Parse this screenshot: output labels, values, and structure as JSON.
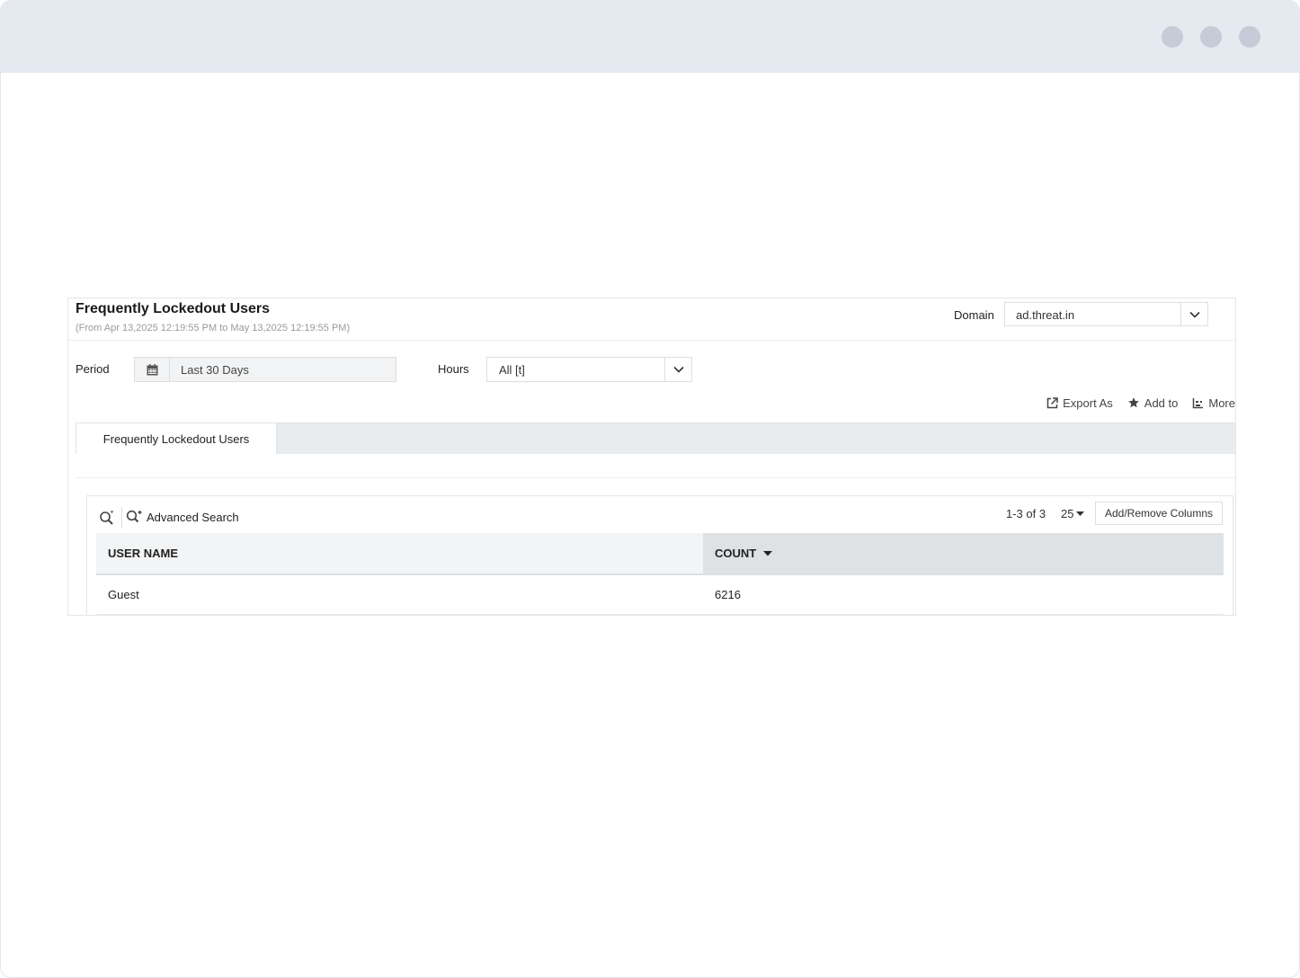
{
  "report": {
    "title": "Frequently Lockedout Users",
    "date_range": "(From Apr 13,2025 12:19:55 PM to May 13,2025 12:19:55 PM)"
  },
  "domain": {
    "label": "Domain",
    "value": "ad.threat.in"
  },
  "period": {
    "label": "Period",
    "value": "Last 30 Days"
  },
  "hours": {
    "label": "Hours",
    "value": "All [t]"
  },
  "actions": {
    "export_label": "Export As",
    "add_to_label": "Add to",
    "more_label": "More"
  },
  "tabs": [
    {
      "label": "Frequently Lockedout Users"
    }
  ],
  "grid": {
    "advanced_search_label": "Advanced Search",
    "pagination": "1-3 of 3",
    "page_size": "25",
    "add_remove_columns_label": "Add/Remove Columns",
    "columns": {
      "user_name": "USER NAME",
      "count": "COUNT"
    },
    "sort": {
      "column": "count",
      "direction": "desc"
    },
    "rows": [
      {
        "user_name": "Guest",
        "count": "6216"
      }
    ]
  },
  "colors": {
    "titlebar": "#e5eaf1",
    "window_dot": "#c5ccd7",
    "header_active": "#dfe2e4",
    "tabstrip": "#e9ecee"
  }
}
